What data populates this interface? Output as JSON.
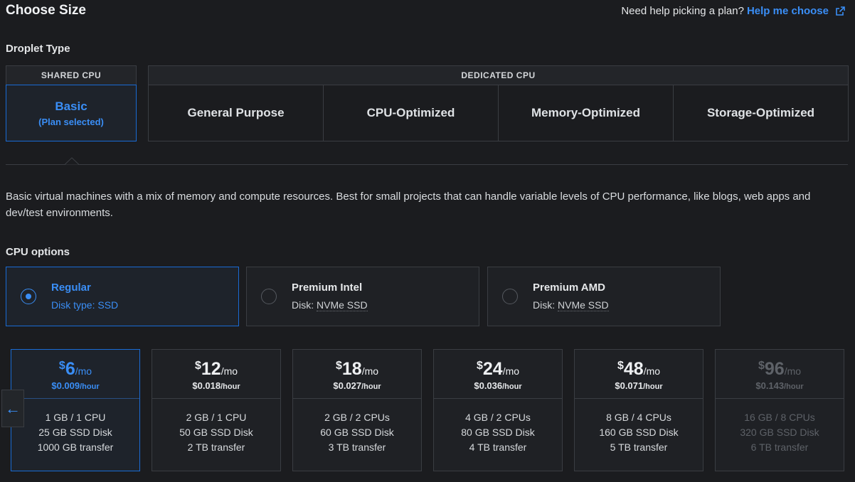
{
  "header": {
    "title": "Choose Size",
    "help_text": "Need help picking a plan?",
    "help_link": "Help me choose"
  },
  "droplet_type": {
    "label": "Droplet Type",
    "shared_heading": "SHARED CPU",
    "dedicated_heading": "DEDICATED CPU",
    "basic": {
      "name": "Basic",
      "note": "(Plan selected)"
    },
    "dedicated_items": [
      "General Purpose",
      "CPU-Optimized",
      "Memory-Optimized",
      "Storage-Optimized"
    ]
  },
  "description": "Basic virtual machines with a mix of memory and compute resources. Best for small projects that can handle variable levels of CPU performance, like blogs, web apps and dev/test environments.",
  "cpu_options": {
    "label": "CPU options",
    "items": [
      {
        "name": "Regular",
        "disk_prefix": "Disk type: ",
        "disk": "SSD",
        "selected": true
      },
      {
        "name": "Premium Intel",
        "disk_prefix": "Disk: ",
        "disk": "NVMe SSD",
        "selected": false
      },
      {
        "name": "Premium AMD",
        "disk_prefix": "Disk: ",
        "disk": "NVMe SSD",
        "selected": false
      }
    ]
  },
  "plans": [
    {
      "currency": "$",
      "amount": "6",
      "per": "/mo",
      "hourly": "$0.009",
      "hour_unit": "/hour",
      "memory_cpu": "1 GB / 1 CPU",
      "disk": "25 GB SSD Disk",
      "transfer": "1000 GB transfer",
      "selected": true,
      "disabled": false
    },
    {
      "currency": "$",
      "amount": "12",
      "per": "/mo",
      "hourly": "$0.018",
      "hour_unit": "/hour",
      "memory_cpu": "2 GB / 1 CPU",
      "disk": "50 GB SSD Disk",
      "transfer": "2 TB transfer",
      "selected": false,
      "disabled": false
    },
    {
      "currency": "$",
      "amount": "18",
      "per": "/mo",
      "hourly": "$0.027",
      "hour_unit": "/hour",
      "memory_cpu": "2 GB / 2 CPUs",
      "disk": "60 GB SSD Disk",
      "transfer": "3 TB transfer",
      "selected": false,
      "disabled": false
    },
    {
      "currency": "$",
      "amount": "24",
      "per": "/mo",
      "hourly": "$0.036",
      "hour_unit": "/hour",
      "memory_cpu": "4 GB / 2 CPUs",
      "disk": "80 GB SSD Disk",
      "transfer": "4 TB transfer",
      "selected": false,
      "disabled": false
    },
    {
      "currency": "$",
      "amount": "48",
      "per": "/mo",
      "hourly": "$0.071",
      "hour_unit": "/hour",
      "memory_cpu": "8 GB / 4 CPUs",
      "disk": "160 GB SSD Disk",
      "transfer": "5 TB transfer",
      "selected": false,
      "disabled": false
    },
    {
      "currency": "$",
      "amount": "96",
      "per": "/mo",
      "hourly": "$0.143",
      "hour_unit": "/hour",
      "memory_cpu": "16 GB / 8 CPUs",
      "disk": "320 GB SSD Disk",
      "transfer": "6 TB transfer",
      "selected": false,
      "disabled": true
    }
  ],
  "icons": {
    "external_link": "external-link-icon",
    "scroll_left": "arrow-left-icon"
  },
  "colors": {
    "accent": "#3a8ef6",
    "background": "#1b1c1f",
    "border": "#3a3d42"
  }
}
